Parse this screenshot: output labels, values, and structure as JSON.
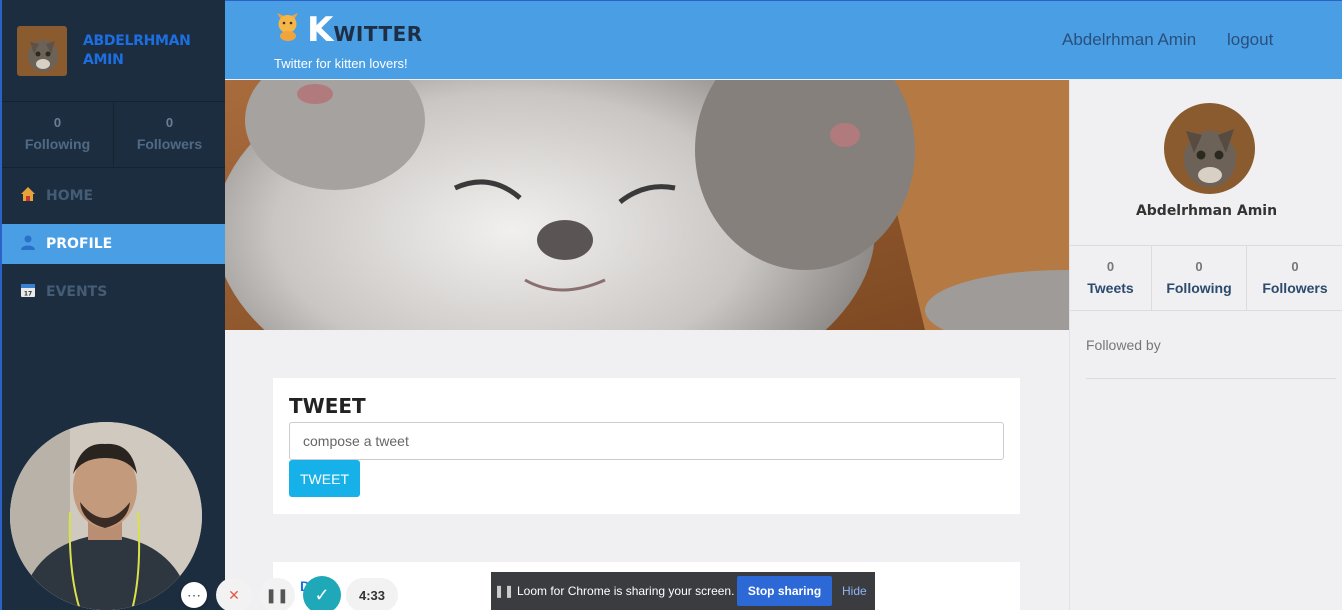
{
  "sidebar": {
    "user_name": "ABDELRHMAN AMIN",
    "stats": [
      {
        "count": "0",
        "label": "Following"
      },
      {
        "count": "0",
        "label": "Followers"
      }
    ],
    "nav": [
      {
        "label": "HOME",
        "icon": "home-icon",
        "active": false
      },
      {
        "label": "PROFILE",
        "icon": "user-icon",
        "active": true
      },
      {
        "label": "EVENTS",
        "icon": "calendar-icon",
        "active": false
      }
    ]
  },
  "header": {
    "logo_k": "K",
    "logo_rest": "WITTER",
    "tagline": "Twitter for kitten lovers!",
    "user_link": "Abdelrhman Amin",
    "logout": "logout"
  },
  "tweet": {
    "title": "TWEET",
    "placeholder": "compose a tweet",
    "button": "TWEET"
  },
  "feed": {
    "partial_label": "D..."
  },
  "profile": {
    "name": "Abdelrhman Amin",
    "stats": [
      {
        "count": "0",
        "label": "Tweets"
      },
      {
        "count": "0",
        "label": "Following"
      },
      {
        "count": "0",
        "label": "Followers"
      }
    ],
    "followed_by": "Followed by"
  },
  "loom": {
    "timer": "4:33",
    "sharing_text": "Loom for Chrome is sharing your screen.",
    "stop": "Stop sharing",
    "hide": "Hide"
  },
  "colors": {
    "header_blue": "#4a9fe4",
    "sidebar_dark": "#1c2d40",
    "tweet_button": "#17b1ea"
  }
}
